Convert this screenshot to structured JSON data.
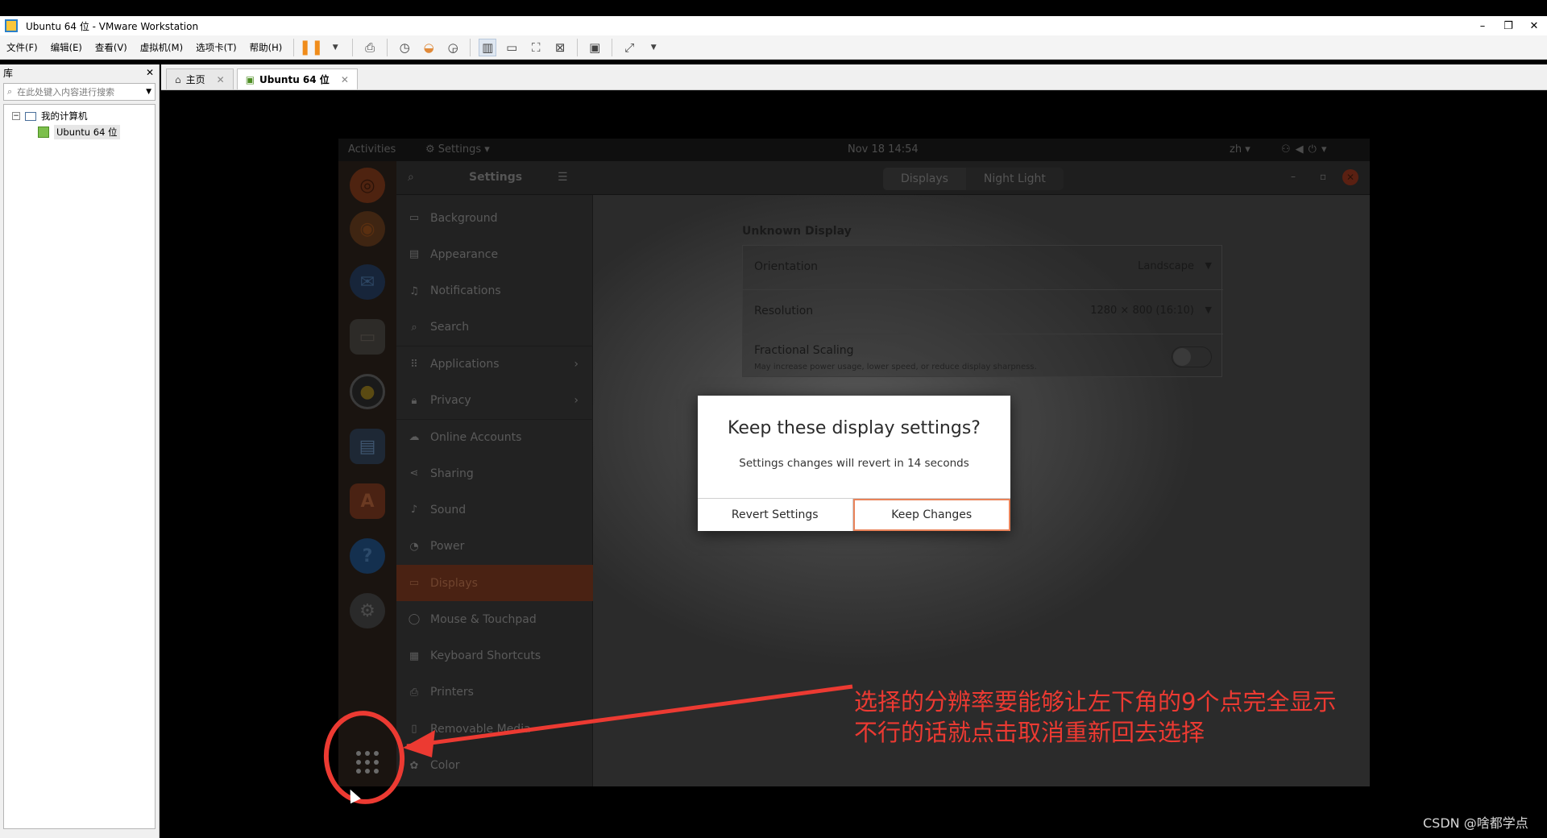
{
  "window": {
    "title": "Ubuntu 64 位 - VMware Workstation",
    "controls": [
      "–",
      "❐",
      "✕"
    ]
  },
  "menubar": {
    "items": [
      "文件(F)",
      "编辑(E)",
      "查看(V)",
      "虚拟机(M)",
      "选项卡(T)",
      "帮助(H)"
    ]
  },
  "library": {
    "title": "库",
    "search_placeholder": "在此处键入内容进行搜索",
    "tree": {
      "root": "我的计算机",
      "child": "Ubuntu 64 位"
    }
  },
  "tabs": [
    {
      "label": "主页"
    },
    {
      "label": "Ubuntu 64 位"
    }
  ],
  "guest": {
    "topbar": {
      "activities": "Activities",
      "app_menu": "Settings ▾",
      "clock": "Nov 18  14:54",
      "lang": "zh ▾"
    },
    "headerbar": {
      "title": "Settings",
      "segments": [
        "Displays",
        "Night Light"
      ]
    },
    "sidebar": [
      {
        "label": "Background",
        "icon": "▭"
      },
      {
        "label": "Appearance",
        "icon": "▤"
      },
      {
        "label": "Notifications",
        "icon": "♫"
      },
      {
        "label": "Search",
        "icon": "⌕"
      },
      {
        "label": "Applications",
        "icon": "⠿",
        "chevron": "›"
      },
      {
        "label": "Privacy",
        "icon": "🔒︎",
        "chevron": "›"
      },
      {
        "label": "Online Accounts",
        "icon": "☁"
      },
      {
        "label": "Sharing",
        "icon": "⋖"
      },
      {
        "label": "Sound",
        "icon": "♪"
      },
      {
        "label": "Power",
        "icon": "◔"
      },
      {
        "label": "Displays",
        "icon": "▭",
        "selected": true
      },
      {
        "label": "Mouse & Touchpad",
        "icon": "◯"
      },
      {
        "label": "Keyboard Shortcuts",
        "icon": "▦"
      },
      {
        "label": "Printers",
        "icon": "⎙"
      },
      {
        "label": "Removable Media",
        "icon": "▯"
      },
      {
        "label": "Color",
        "icon": "✿"
      }
    ],
    "display": {
      "section_title": "Unknown Display",
      "orientation": {
        "label": "Orientation",
        "value": "Landscape"
      },
      "resolution": {
        "label": "Resolution",
        "value": "1280 × 800 (16:10)"
      },
      "scaling": {
        "label": "Fractional Scaling",
        "sub": "May increase power usage, lower speed, or reduce display sharpness."
      }
    }
  },
  "dialog": {
    "title": "Keep these display settings?",
    "message": "Settings changes will revert in 14 seconds",
    "revert_label": "Revert Settings",
    "keep_label": "Keep Changes"
  },
  "annotation": {
    "line1": "选择的分辨率要能够让左下角的9个点完全显示",
    "line2": "不行的话就点击取消重新回去选择",
    "color": "#ec3a32"
  },
  "watermark": "CSDN @啥都学点",
  "colors": {
    "accent_orange": "#e9835a",
    "selected_row": "#4a2213"
  }
}
